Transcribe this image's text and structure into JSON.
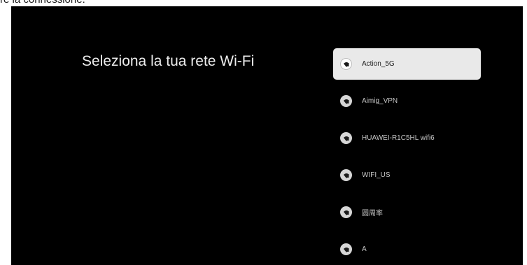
{
  "caption": "re la connessione.",
  "title": "Seleziona la tua rete Wi-Fi",
  "colors": {
    "screen_bg": "#000000",
    "selected_bg": "#e9e9e9"
  },
  "networks": [
    {
      "name": "Action_5G",
      "icon": "wifi-lock-icon",
      "selected": true
    },
    {
      "name": "Aimig_VPN",
      "icon": "wifi-lock-icon",
      "selected": false
    },
    {
      "name": "HUAWEI-R1C5HL wifi6",
      "icon": "wifi-lock-icon",
      "selected": false
    },
    {
      "name": "WIFI_US",
      "icon": "wifi-lock-icon",
      "selected": false
    },
    {
      "name": "圆周率",
      "icon": "wifi-lock-icon",
      "selected": false
    },
    {
      "name": "A",
      "icon": "wifi-lock-icon",
      "selected": false
    }
  ]
}
